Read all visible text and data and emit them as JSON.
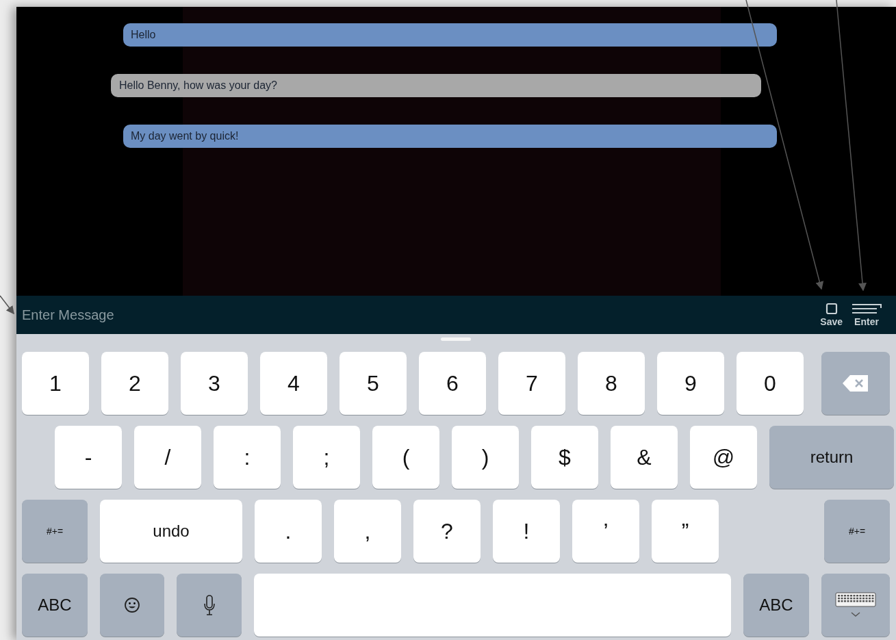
{
  "messages": [
    {
      "text": "Hello",
      "kind": "outgoing"
    },
    {
      "text": "Hello Benny, how was your day?",
      "kind": "incoming"
    },
    {
      "text": "My day went by quick!",
      "kind": "outgoing"
    }
  ],
  "input": {
    "placeholder": "Enter Message",
    "actions": [
      {
        "label": "Save",
        "kind": "save"
      },
      {
        "label": "Enter",
        "kind": "enter"
      }
    ]
  },
  "keyboard": {
    "rows": [
      [
        {
          "label": "1",
          "kind": "char"
        },
        {
          "label": "2",
          "kind": "char"
        },
        {
          "label": "3",
          "kind": "char"
        },
        {
          "label": "4",
          "kind": "char"
        },
        {
          "label": "5",
          "kind": "char"
        },
        {
          "label": "6",
          "kind": "char"
        },
        {
          "label": "7",
          "kind": "char"
        },
        {
          "label": "8",
          "kind": "char"
        },
        {
          "label": "9",
          "kind": "char"
        },
        {
          "label": "0",
          "kind": "char"
        },
        {
          "kind": "delete"
        }
      ],
      [
        {
          "label": "-",
          "kind": "char"
        },
        {
          "label": "/",
          "kind": "char"
        },
        {
          "label": ":",
          "kind": "char"
        },
        {
          "label": ";",
          "kind": "char"
        },
        {
          "label": "(",
          "kind": "char"
        },
        {
          "label": ")",
          "kind": "char"
        },
        {
          "label": "$",
          "kind": "char"
        },
        {
          "label": "&",
          "kind": "char"
        },
        {
          "label": "@",
          "kind": "char"
        },
        {
          "label": "return",
          "kind": "return"
        }
      ],
      [
        {
          "label": "#+=",
          "kind": "modifier"
        },
        {
          "label": "undo",
          "kind": "undo"
        },
        {
          "label": ".",
          "kind": "char"
        },
        {
          "label": ",",
          "kind": "char"
        },
        {
          "label": "?",
          "kind": "char"
        },
        {
          "label": "!",
          "kind": "char"
        },
        {
          "label": "’",
          "kind": "char"
        },
        {
          "label": "”",
          "kind": "char"
        },
        {
          "label": "#+=",
          "kind": "modifier"
        }
      ],
      [
        {
          "label": "ABC",
          "kind": "modifier"
        },
        {
          "kind": "emoji"
        },
        {
          "kind": "mic"
        },
        {
          "kind": "space"
        },
        {
          "label": "ABC",
          "kind": "modifier"
        },
        {
          "kind": "hide"
        }
      ]
    ]
  }
}
